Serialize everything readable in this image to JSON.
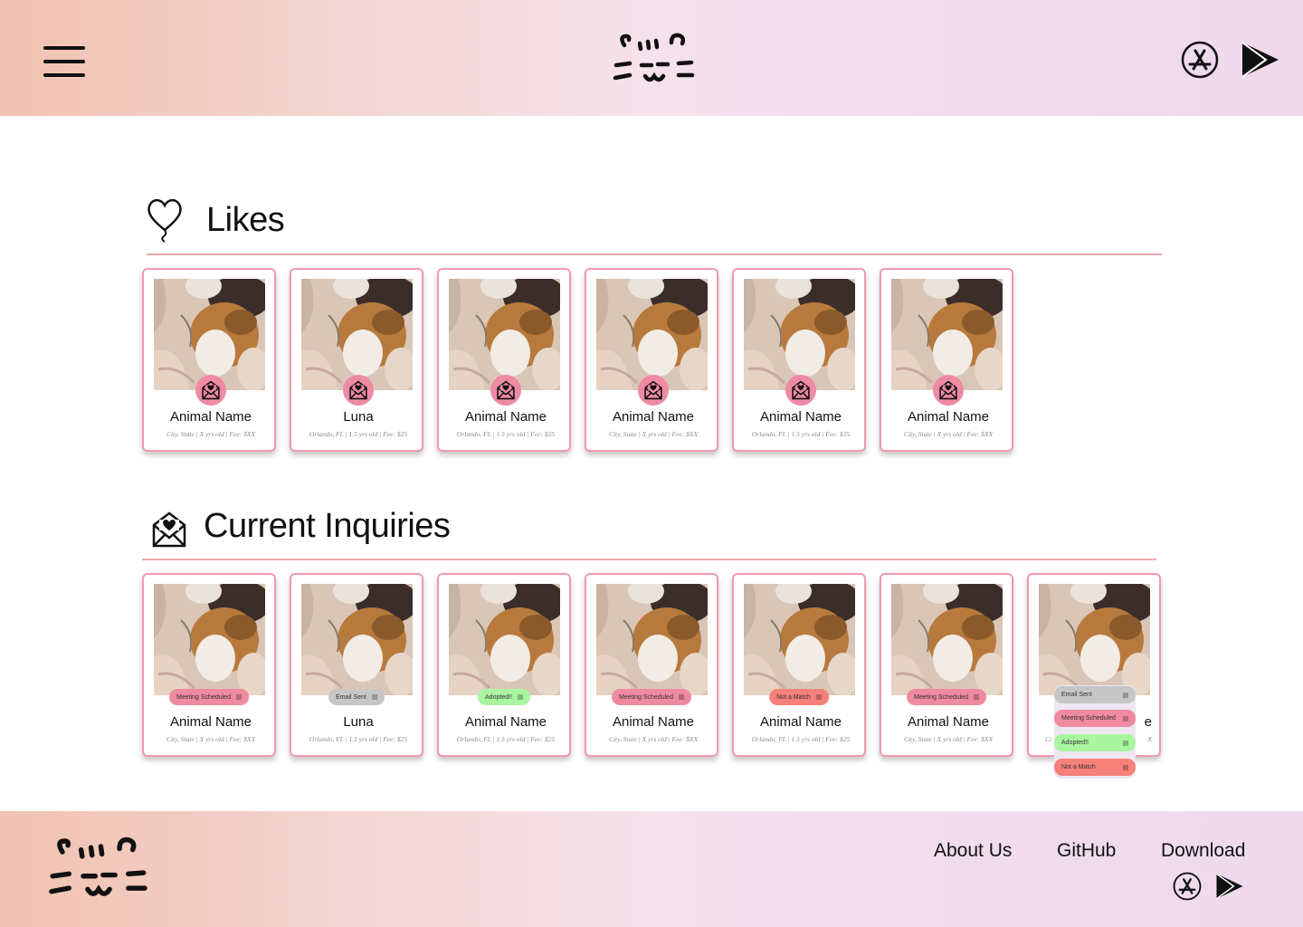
{
  "colors": {
    "accent_pink": "#ef9aae",
    "badge_pink": "#ef8aa4",
    "rule_pink": "#f0a6b1"
  },
  "header": {
    "menu_icon": "hamburger-icon",
    "logo": "cat-face-logo",
    "app_store_icon": "app-store-icon",
    "play_store_icon": "google-play-icon"
  },
  "likes": {
    "title": "Likes",
    "icon": "heart-balloon-icon",
    "cards": [
      {
        "name": "Animal Name",
        "meta": "City, State  |  X yrs old  |  Fee: $XX"
      },
      {
        "name": "Luna",
        "meta": "Orlando, FL  |  1.5 yrs old  |  Fee: $25"
      },
      {
        "name": "Animal Name",
        "meta": "Orlando, FL  |  1.5 yrs old  |  Fee: $25"
      },
      {
        "name": "Animal Name",
        "meta": "City, State  |  X yrs old  |  Fee: $XX"
      },
      {
        "name": "Animal Name",
        "meta": "Orlando, FL  |  1.5 yrs old  |  Fee: $25"
      },
      {
        "name": "Animal Name",
        "meta": "City, State  |  X yrs old  |  Fee: $XX"
      }
    ]
  },
  "inquiries": {
    "title": "Current Inquiries",
    "icon": "mail-heart-icon",
    "cards": [
      {
        "name": "Animal Name",
        "meta": "City, State  |  X yrs old  |  Fee: $XX",
        "status": "Meeting Scheduled",
        "status_color": "#f08aa0"
      },
      {
        "name": "Luna",
        "meta": "Orlando, FL  |  1.5 yrs old  |  Fee: $25",
        "status": "Email Sent",
        "status_color": "#c6c6c6"
      },
      {
        "name": "Animal Name",
        "meta": "Orlando, FL  |  1.5 yrs old  |  Fee: $25",
        "status": "Adopted!!",
        "status_color": "#a9f5a0"
      },
      {
        "name": "Animal Name",
        "meta": "City, State  |  X yrs old  |  Fee: $XX",
        "status": "Meeting Scheduled",
        "status_color": "#f08aa0"
      },
      {
        "name": "Animal Name",
        "meta": "Orlando, FL  |  1.5 yrs old  |  Fee: $25",
        "status": "Not a Match",
        "status_color": "#f6807a"
      },
      {
        "name": "Animal Name",
        "meta": "City, State  |  X yrs old  |  Fee: $XX",
        "status": "Meeting Scheduled",
        "status_color": "#f08aa0"
      },
      {
        "name_visible": "e",
        "meta_left": "Ci",
        "meta_right": "X"
      }
    ],
    "dropdown": [
      {
        "label": "Email Sent",
        "color": "#c6c6c6"
      },
      {
        "label": "Meeting Scheduled",
        "color": "#f08aa0"
      },
      {
        "label": "Adopted!!",
        "color": "#a9f5a0"
      },
      {
        "label": "Not a Match",
        "color": "#f6807a"
      }
    ]
  },
  "footer": {
    "logo": "cat-face-logo",
    "links": [
      "About Us",
      "GitHub",
      "Download"
    ],
    "app_store_icon": "app-store-icon",
    "play_store_icon": "google-play-icon"
  }
}
